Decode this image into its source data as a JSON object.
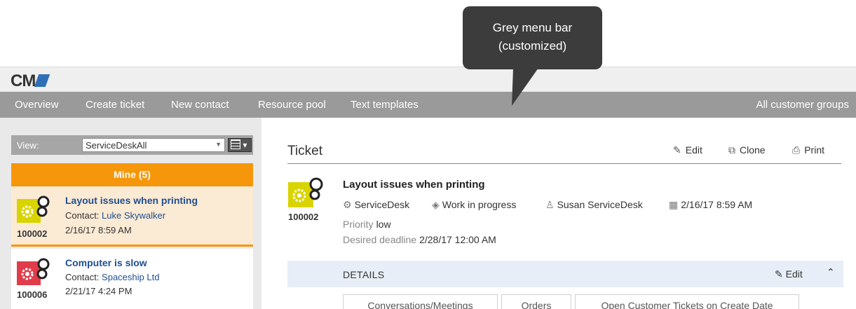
{
  "callout": {
    "line1": "Grey menu bar",
    "line2": "(customized)"
  },
  "logo": {
    "text": "CM"
  },
  "menu": {
    "items": [
      "Overview",
      "Create ticket",
      "New contact",
      "Resource pool",
      "Text templates"
    ],
    "right": "All customer groups"
  },
  "sidebar": {
    "view_label": "View:",
    "view_value": "ServiceDeskAll",
    "mine_header": "Mine (5)",
    "tickets": [
      {
        "id": "100002",
        "title": "Layout issues when printing",
        "contact_label": "Contact:",
        "contact": "Luke Skywalker",
        "date": "2/16/17 8:59 AM",
        "icon_color": "#d9d400"
      },
      {
        "id": "100006",
        "title": "Computer is slow",
        "contact_label": "Contact:",
        "contact": "Spaceship Ltd",
        "date": "2/21/17 4:24 PM",
        "icon_color": "#e03c4a"
      }
    ]
  },
  "ticket": {
    "heading": "Ticket",
    "actions": {
      "edit": "Edit",
      "clone": "Clone",
      "print": "Print"
    },
    "id": "100002",
    "title": "Layout issues when printing",
    "category": "ServiceDesk",
    "status": "Work in progress",
    "agent": "Susan ServiceDesk",
    "date": "2/16/17 8:59 AM",
    "priority_label": "Priority",
    "priority": "low",
    "deadline_label": "Desired deadline",
    "deadline": "2/28/17 12:00 AM",
    "details_label": "DETAILS",
    "details_edit": "Edit",
    "tabs": [
      "Conversations/Meetings",
      "Orders",
      "Open Customer Tickets on Create Date"
    ]
  },
  "colors": {
    "accent": "#f6960a",
    "menu_bar": "#9a9a9a",
    "link": "#1f4f8f",
    "details_bg": "#e8eef7"
  }
}
